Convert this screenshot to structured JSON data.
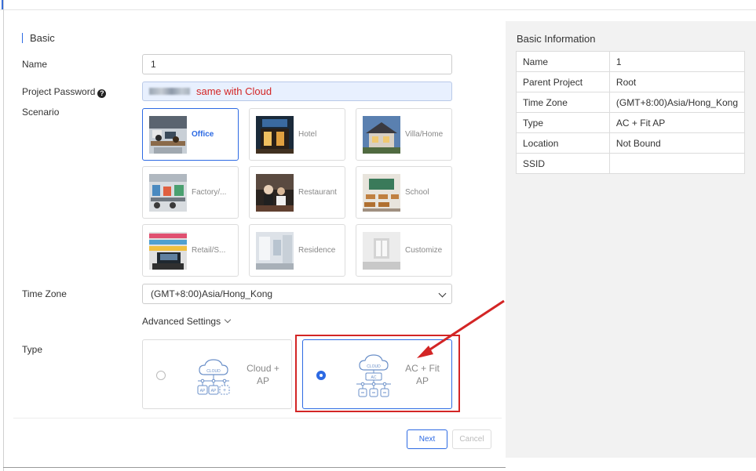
{
  "form": {
    "section_title": "Basic",
    "name_label": "Name",
    "name_value": "1",
    "password_label": "Project Password",
    "password_note": "same with Cloud",
    "scenario_label": "Scenario",
    "scenarios": [
      {
        "label": "Office",
        "selected": true,
        "icon": "office-photo"
      },
      {
        "label": "Hotel",
        "selected": false,
        "icon": "hotel-photo"
      },
      {
        "label": "Villa/Home",
        "selected": false,
        "icon": "villa-photo"
      },
      {
        "label": "Factory/...",
        "selected": false,
        "icon": "factory-photo"
      },
      {
        "label": "Restaurant",
        "selected": false,
        "icon": "restaurant-photo"
      },
      {
        "label": "School",
        "selected": false,
        "icon": "school-photo"
      },
      {
        "label": "Retail/S...",
        "selected": false,
        "icon": "retail-photo"
      },
      {
        "label": "Residence",
        "selected": false,
        "icon": "residence-photo"
      },
      {
        "label": "Customize",
        "selected": false,
        "icon": "customize-photo"
      }
    ],
    "timezone_label": "Time Zone",
    "timezone_value": "(GMT+8:00)Asia/Hong_Kong",
    "advanced_settings": "Advanced Settings",
    "type_label": "Type",
    "types": [
      {
        "line1": "Cloud +",
        "line2": "AP",
        "selected": false,
        "diagram_cloud_text": "CLOUD",
        "diagram_nodes": [
          "AP",
          "AP",
          "+"
        ]
      },
      {
        "line1": "AC + Fit",
        "line2": "AP",
        "selected": true,
        "diagram_cloud_text": "CLOUD",
        "diagram_ac_text": "AC"
      }
    ],
    "next_label": "Next",
    "cancel_label": "Cancel"
  },
  "info": {
    "title": "Basic Information",
    "rows": [
      {
        "key": "Name",
        "value": "1"
      },
      {
        "key": "Parent Project",
        "value": "Root"
      },
      {
        "key": "Time Zone",
        "value": "(GMT+8:00)Asia/Hong_Kong"
      },
      {
        "key": "Type",
        "value": "AC + Fit AP"
      },
      {
        "key": "Location",
        "value": "Not Bound"
      },
      {
        "key": "SSID",
        "value": ""
      }
    ]
  },
  "colors": {
    "accent": "#2d6ae3",
    "annotation_red": "#d32525",
    "panel_bg": "#f2f2f2"
  }
}
